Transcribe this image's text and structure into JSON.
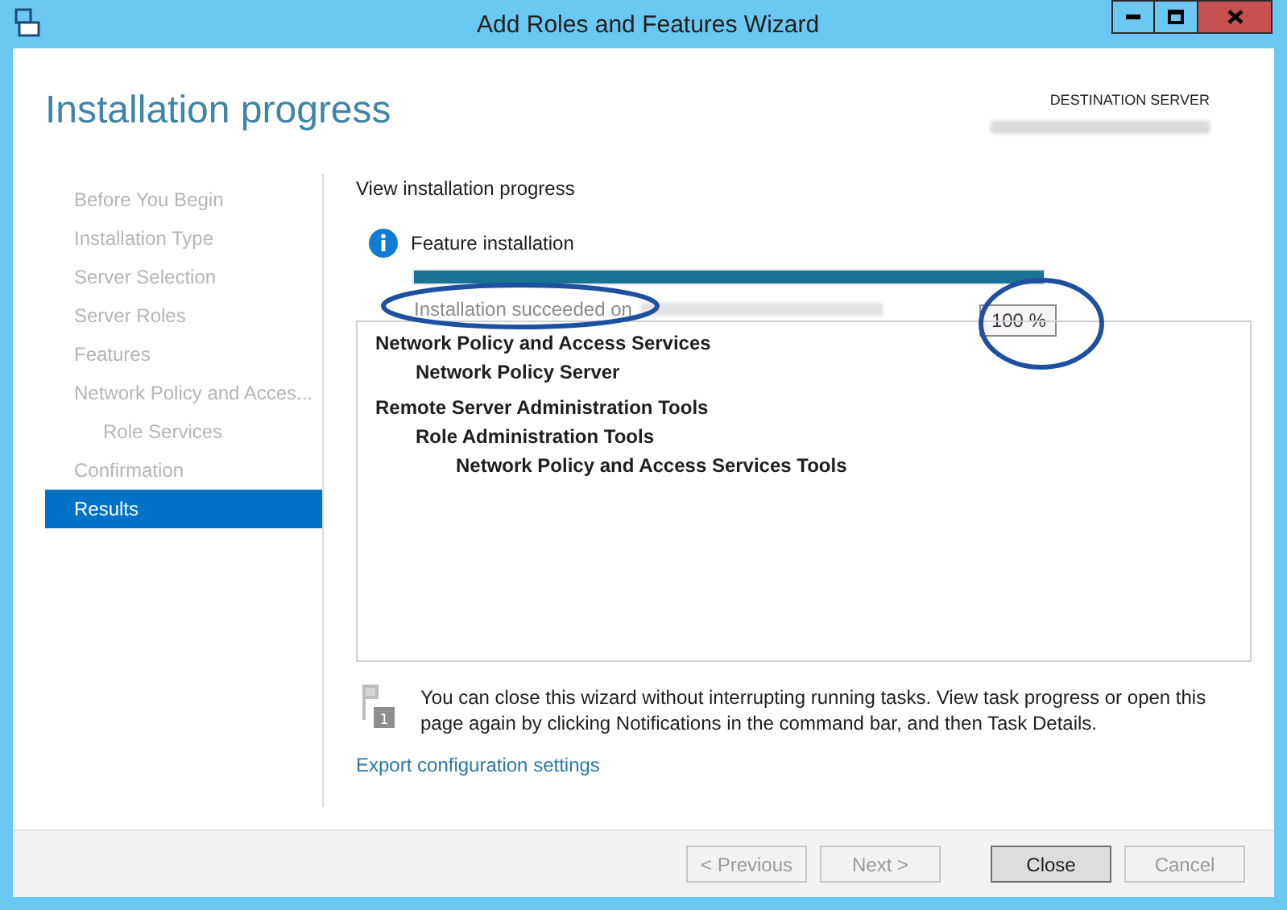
{
  "window": {
    "title": "Add Roles and Features Wizard"
  },
  "header": {
    "title": "Installation progress",
    "destination_label": "DESTINATION SERVER"
  },
  "sidebar": {
    "items": [
      {
        "label": "Before You Begin",
        "selected": false
      },
      {
        "label": "Installation Type",
        "selected": false
      },
      {
        "label": "Server Selection",
        "selected": false
      },
      {
        "label": "Server Roles",
        "selected": false
      },
      {
        "label": "Features",
        "selected": false
      },
      {
        "label": "Network Policy and Acces...",
        "selected": false,
        "children": [
          {
            "label": "Role Services",
            "selected": false
          }
        ]
      },
      {
        "label": "Confirmation",
        "selected": false
      },
      {
        "label": "Results",
        "selected": true
      }
    ]
  },
  "main": {
    "heading": "View installation progress",
    "task": "Feature installation",
    "progress": {
      "level": 1
    },
    "status": "Installation succeeded on",
    "percent": "100 %",
    "results": [
      {
        "label": "Network Policy and Access Services",
        "children": [
          {
            "label": "Network Policy Server"
          }
        ]
      },
      {
        "label": "Remote Server Administration Tools",
        "children": [
          {
            "label": "Role Administration Tools",
            "children": [
              {
                "label": "Network Policy and Access Services Tools"
              }
            ]
          }
        ]
      }
    ],
    "note_badge": "1",
    "note": "You can close this wizard without interrupting running tasks. View task progress or open this page again by clicking Notifications in the command bar, and then Task Details.",
    "link": "Export configuration settings"
  },
  "buttons": [
    {
      "label": "< Previous",
      "disabled": true,
      "default": false
    },
    {
      "label": "Next >",
      "disabled": true,
      "default": false
    },
    {
      "label": "Close",
      "disabled": false,
      "default": true
    },
    {
      "label": "Cancel",
      "disabled": true,
      "default": false
    }
  ]
}
